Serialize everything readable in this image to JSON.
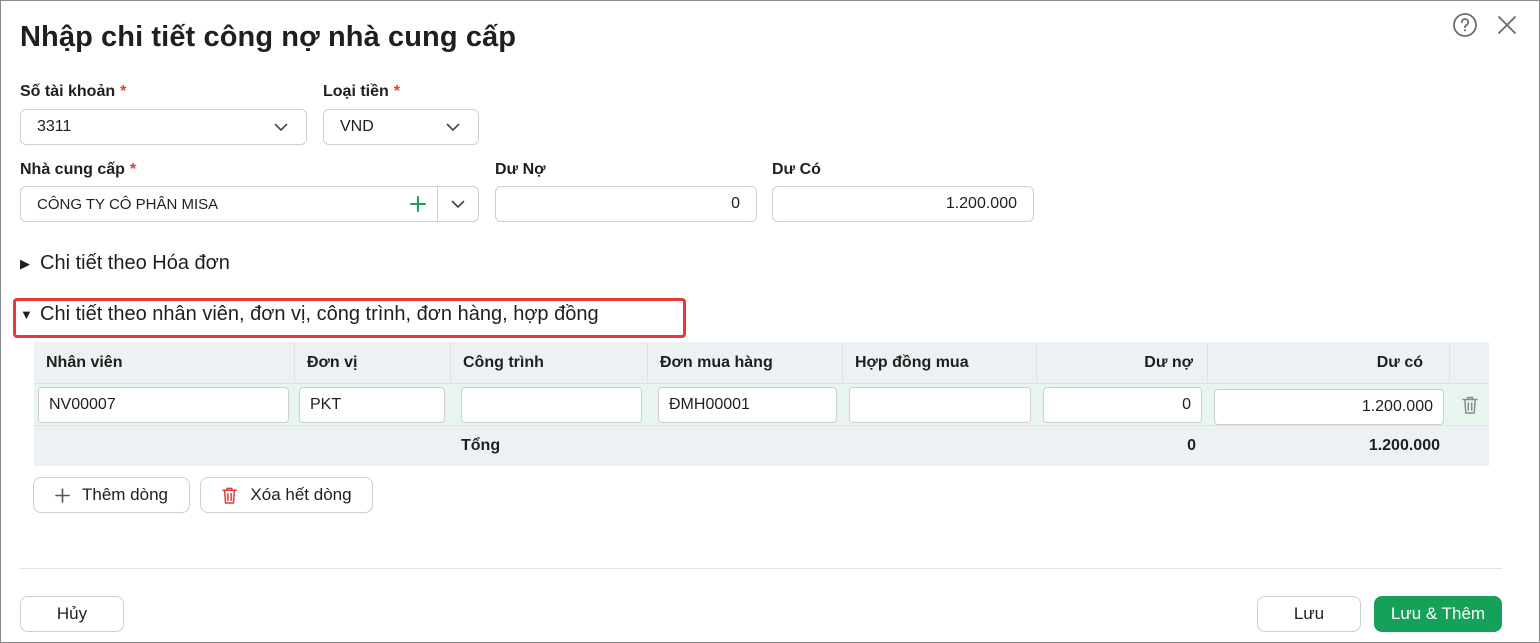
{
  "dialog": {
    "title": "Nhập chi tiết công nợ nhà cung cấp"
  },
  "form": {
    "account_label": "Số tài khoản",
    "account_value": "3311",
    "currency_label": "Loại tiền",
    "currency_value": "VND",
    "supplier_label": "Nhà cung cấp",
    "supplier_value": "CÔNG TY CÔ PHÂN MISA",
    "debit_label": "Dư Nợ",
    "debit_value": "0",
    "credit_label": "Dư Có",
    "credit_value": "1.200.000",
    "required_mark": "*"
  },
  "sections": {
    "invoice_detail": "Chi tiết theo Hóa đơn",
    "employee_detail": "Chi tiết theo nhân viên, đơn vị, công trình, đơn hàng, hợp đồng"
  },
  "grid": {
    "columns": [
      "Nhân viên",
      "Đơn vị",
      "Công trình",
      "Đơn mua hàng",
      "Hợp đồng mua",
      "Dư nợ",
      "Dư có"
    ],
    "rows": [
      {
        "employee": "NV00007",
        "unit": "PKT",
        "project": "",
        "purchase_order": "ĐMH00001",
        "contract": "",
        "debit": "0",
        "credit": "1.200.000"
      }
    ],
    "total_label": "Tổng",
    "total_debit": "0",
    "total_credit": "1.200.000"
  },
  "actions": {
    "add_row": "Thêm dòng",
    "delete_all": "Xóa hết dòng",
    "cancel": "Hủy",
    "save": "Lưu",
    "save_add": "Lưu & Thêm"
  },
  "colors": {
    "primary": "#16a15a",
    "required": "#e5393b",
    "highlight": "#e5393b"
  }
}
